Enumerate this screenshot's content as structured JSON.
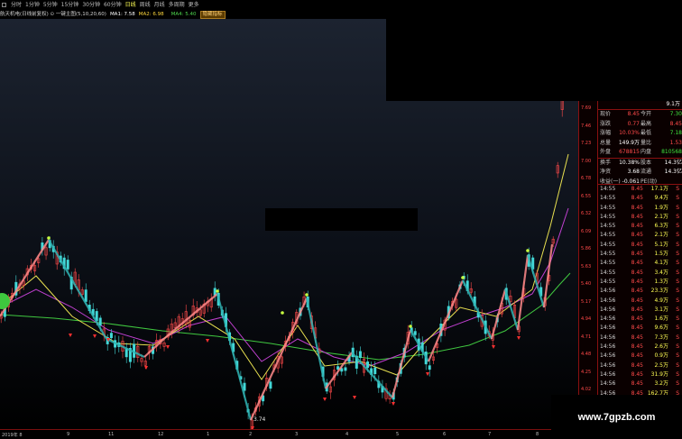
{
  "toolbar": {
    "items": [
      "分时",
      "1分钟",
      "5分钟",
      "15分钟",
      "30分钟",
      "60分钟",
      "日线",
      "周线",
      "月线",
      "多周期",
      "更多"
    ],
    "active_index": 6
  },
  "indicator": {
    "title": "航天机电(日线前复权) ⊙ 一键主图(5,10,20,60)",
    "ma1": "MA1: 7.58",
    "ma2": "MA2: 6.98",
    "ma3": "",
    "ma4": "MA4: 5.40",
    "button": "隐藏指标"
  },
  "chart": {
    "low_label": "3.74",
    "x_ticks": [
      "2019年 8",
      "9",
      "11",
      "12",
      "1",
      "2",
      "3",
      "4",
      "5",
      "6",
      "7",
      "8"
    ],
    "colors": {
      "background_top": "#1c2330",
      "background_bottom": "#000000",
      "up_candle": "#ff4a4a",
      "down_candle": "#43d8d8",
      "zigzag_up": "#ff8a8a",
      "zigzag_down": "#2fb5b5",
      "ma_yellow": "#e8e050",
      "ma_magenta": "#c040d0",
      "ma_green": "#40c840"
    }
  },
  "right_panel": {
    "head_value": "9.1万",
    "price_scale": [
      "7.69",
      "7.46",
      "7.23",
      "7.00",
      "6.78",
      "6.55",
      "6.32",
      "6.09",
      "5.86",
      "5.63",
      "5.40",
      "5.17",
      "4.94",
      "4.71",
      "4.48",
      "4.25",
      "4.02"
    ],
    "quote": [
      {
        "k": "现价",
        "v": "8.45",
        "k2": "今开",
        "v2": "7.30",
        "v2c": "green"
      },
      {
        "k": "涨跌",
        "v": "0.77",
        "k2": "最高",
        "v2": "8.45",
        "v2c": "red"
      },
      {
        "k": "涨幅",
        "v": "10.03%",
        "k2": "最低",
        "v2": "7.18",
        "v2c": "green"
      },
      {
        "k": "总量",
        "v": "149.9万",
        "k2": "量比",
        "v2": "1.53",
        "v2c": "red",
        "vc": "white"
      },
      {
        "k": "外盘",
        "v": "678815",
        "k2": "内盘",
        "v2": "810568",
        "v2c": "green"
      },
      {
        "k": "换手",
        "v": "10.38%",
        "k2": "股本",
        "v2": "14.3亿",
        "v2c": "white",
        "vc": "white",
        "sep": true
      },
      {
        "k": "净资",
        "v": "3.68",
        "k2": "流通",
        "v2": "14.3亿",
        "v2c": "white",
        "vc": "white"
      },
      {
        "k": "收益(一)",
        "v": "-0.061",
        "k2": "PE(动)",
        "v2": "",
        "v2c": "white",
        "vc": "white"
      }
    ],
    "trades": [
      {
        "t": "14:55",
        "p": "8.45",
        "vol": "17.1万",
        "d": "S"
      },
      {
        "t": "14:55",
        "p": "8.45",
        "vol": "9.4万",
        "d": "S"
      },
      {
        "t": "14:55",
        "p": "8.45",
        "vol": "1.9万",
        "d": "S"
      },
      {
        "t": "14:55",
        "p": "8.45",
        "vol": "2.1万",
        "d": "S"
      },
      {
        "t": "14:55",
        "p": "8.45",
        "vol": "6.3万",
        "d": "S"
      },
      {
        "t": "14:55",
        "p": "8.45",
        "vol": "2.1万",
        "d": "S"
      },
      {
        "t": "14:55",
        "p": "8.45",
        "vol": "5.1万",
        "d": "S"
      },
      {
        "t": "14:55",
        "p": "8.45",
        "vol": "1.5万",
        "d": "S"
      },
      {
        "t": "14:55",
        "p": "8.45",
        "vol": "4.1万",
        "d": "S"
      },
      {
        "t": "14:55",
        "p": "8.45",
        "vol": "3.4万",
        "d": "S"
      },
      {
        "t": "14:55",
        "p": "8.45",
        "vol": "1.3万",
        "d": "S"
      },
      {
        "t": "14:56",
        "p": "8.45",
        "vol": "23.3万",
        "d": "S"
      },
      {
        "t": "14:56",
        "p": "8.45",
        "vol": "4.9万",
        "d": "S"
      },
      {
        "t": "14:56",
        "p": "8.45",
        "vol": "3.1万",
        "d": "S"
      },
      {
        "t": "14:56",
        "p": "8.45",
        "vol": "1.6万",
        "d": "S"
      },
      {
        "t": "14:56",
        "p": "8.45",
        "vol": "9.6万",
        "d": "S"
      },
      {
        "t": "14:56",
        "p": "8.45",
        "vol": "7.3万",
        "d": "S"
      },
      {
        "t": "14:56",
        "p": "8.45",
        "vol": "2.6万",
        "d": "S"
      },
      {
        "t": "14:56",
        "p": "8.45",
        "vol": "0.9万",
        "d": "S"
      },
      {
        "t": "14:56",
        "p": "8.45",
        "vol": "2.5万",
        "d": "S"
      },
      {
        "t": "14:56",
        "p": "8.45",
        "vol": "31.9万",
        "d": "S"
      },
      {
        "t": "14:56",
        "p": "8.45",
        "vol": "3.2万",
        "d": "S"
      },
      {
        "t": "14:56",
        "p": "8.45",
        "vol": "162.7万",
        "d": "S"
      }
    ]
  },
  "watermark": "www.7gpzb.com"
}
